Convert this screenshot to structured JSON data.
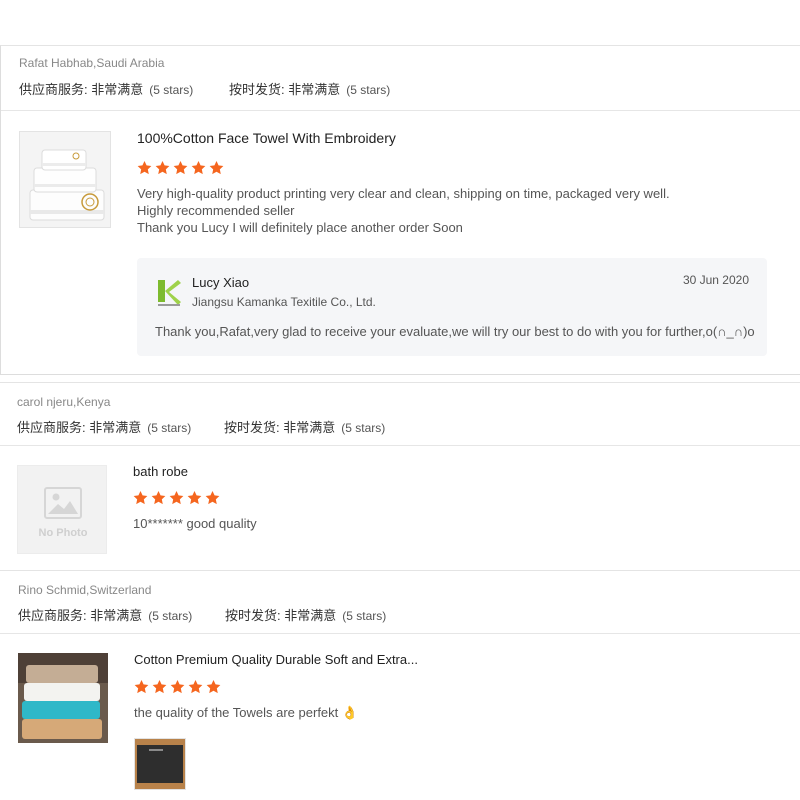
{
  "reviews": [
    {
      "buyer": "Rafat Habhab,Saudi Arabia",
      "supplier_label": "供应商服务: 非常满意",
      "supplier_stars": "(5 stars)",
      "shipping_label": "按时发货: 非常满意",
      "shipping_stars": "(5 stars)",
      "product_title": "100%Cotton Face Towel With Embroidery",
      "rating": 5,
      "text_lines": [
        "Very high-quality product printing very clear and clean, shipping on time, packaged very well.",
        "Highly recommended seller",
        "Thank you Lucy I will definitely place another order Soon"
      ],
      "reply": {
        "name": "Lucy Xiao",
        "company": "Jiangsu Kamanka Texitile Co., Ltd.",
        "date": "30 Jun 2020",
        "text": "Thank you,Rafat,very glad to receive your evaluate,we will try our best to do with you for further,o(∩_∩)o"
      }
    },
    {
      "buyer": "carol njeru,Kenya",
      "supplier_label": "供应商服务: 非常满意",
      "supplier_stars": "(5 stars)",
      "shipping_label": "按时发货: 非常满意",
      "shipping_stars": "(5 stars)",
      "product_title": "bath robe",
      "rating": 5,
      "text_lines": [
        "10******* good quality"
      ],
      "no_photo": "No Photo"
    },
    {
      "buyer": "Rino Schmid,Switzerland",
      "supplier_label": "供应商服务: 非常满意",
      "supplier_stars": "(5 stars)",
      "shipping_label": "按时发货: 非常满意",
      "shipping_stars": "(5 stars)",
      "product_title": "Cotton Premium Quality Durable Soft and Extra...",
      "rating": 5,
      "text_lines": [
        "the quality of the Towels are perfekt 👌"
      ]
    }
  ],
  "colors": {
    "star": "#f5661f",
    "reply_bg": "#f5f6f8",
    "divider": "#e6e6e6"
  },
  "icons": {
    "star": "star-icon",
    "no_photo": "image-placeholder-icon",
    "supplier_logo": "k-logo-icon"
  }
}
